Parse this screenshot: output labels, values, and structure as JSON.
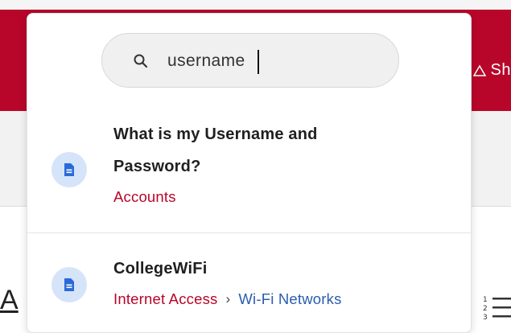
{
  "background": {
    "header_text": "Sh",
    "body_letter": "A",
    "colors": {
      "header": "#b8062a",
      "accent_link": "#2a5db0"
    }
  },
  "search": {
    "value": "username",
    "icon": "search-icon"
  },
  "results": [
    {
      "title": "What is my Username and Password?",
      "icon": "document-icon",
      "crumbs": [
        "Accounts"
      ]
    },
    {
      "title": "CollegeWiFi",
      "icon": "document-icon",
      "crumbs": [
        "Internet Access",
        "Wi-Fi Networks"
      ],
      "separator": "›"
    }
  ]
}
